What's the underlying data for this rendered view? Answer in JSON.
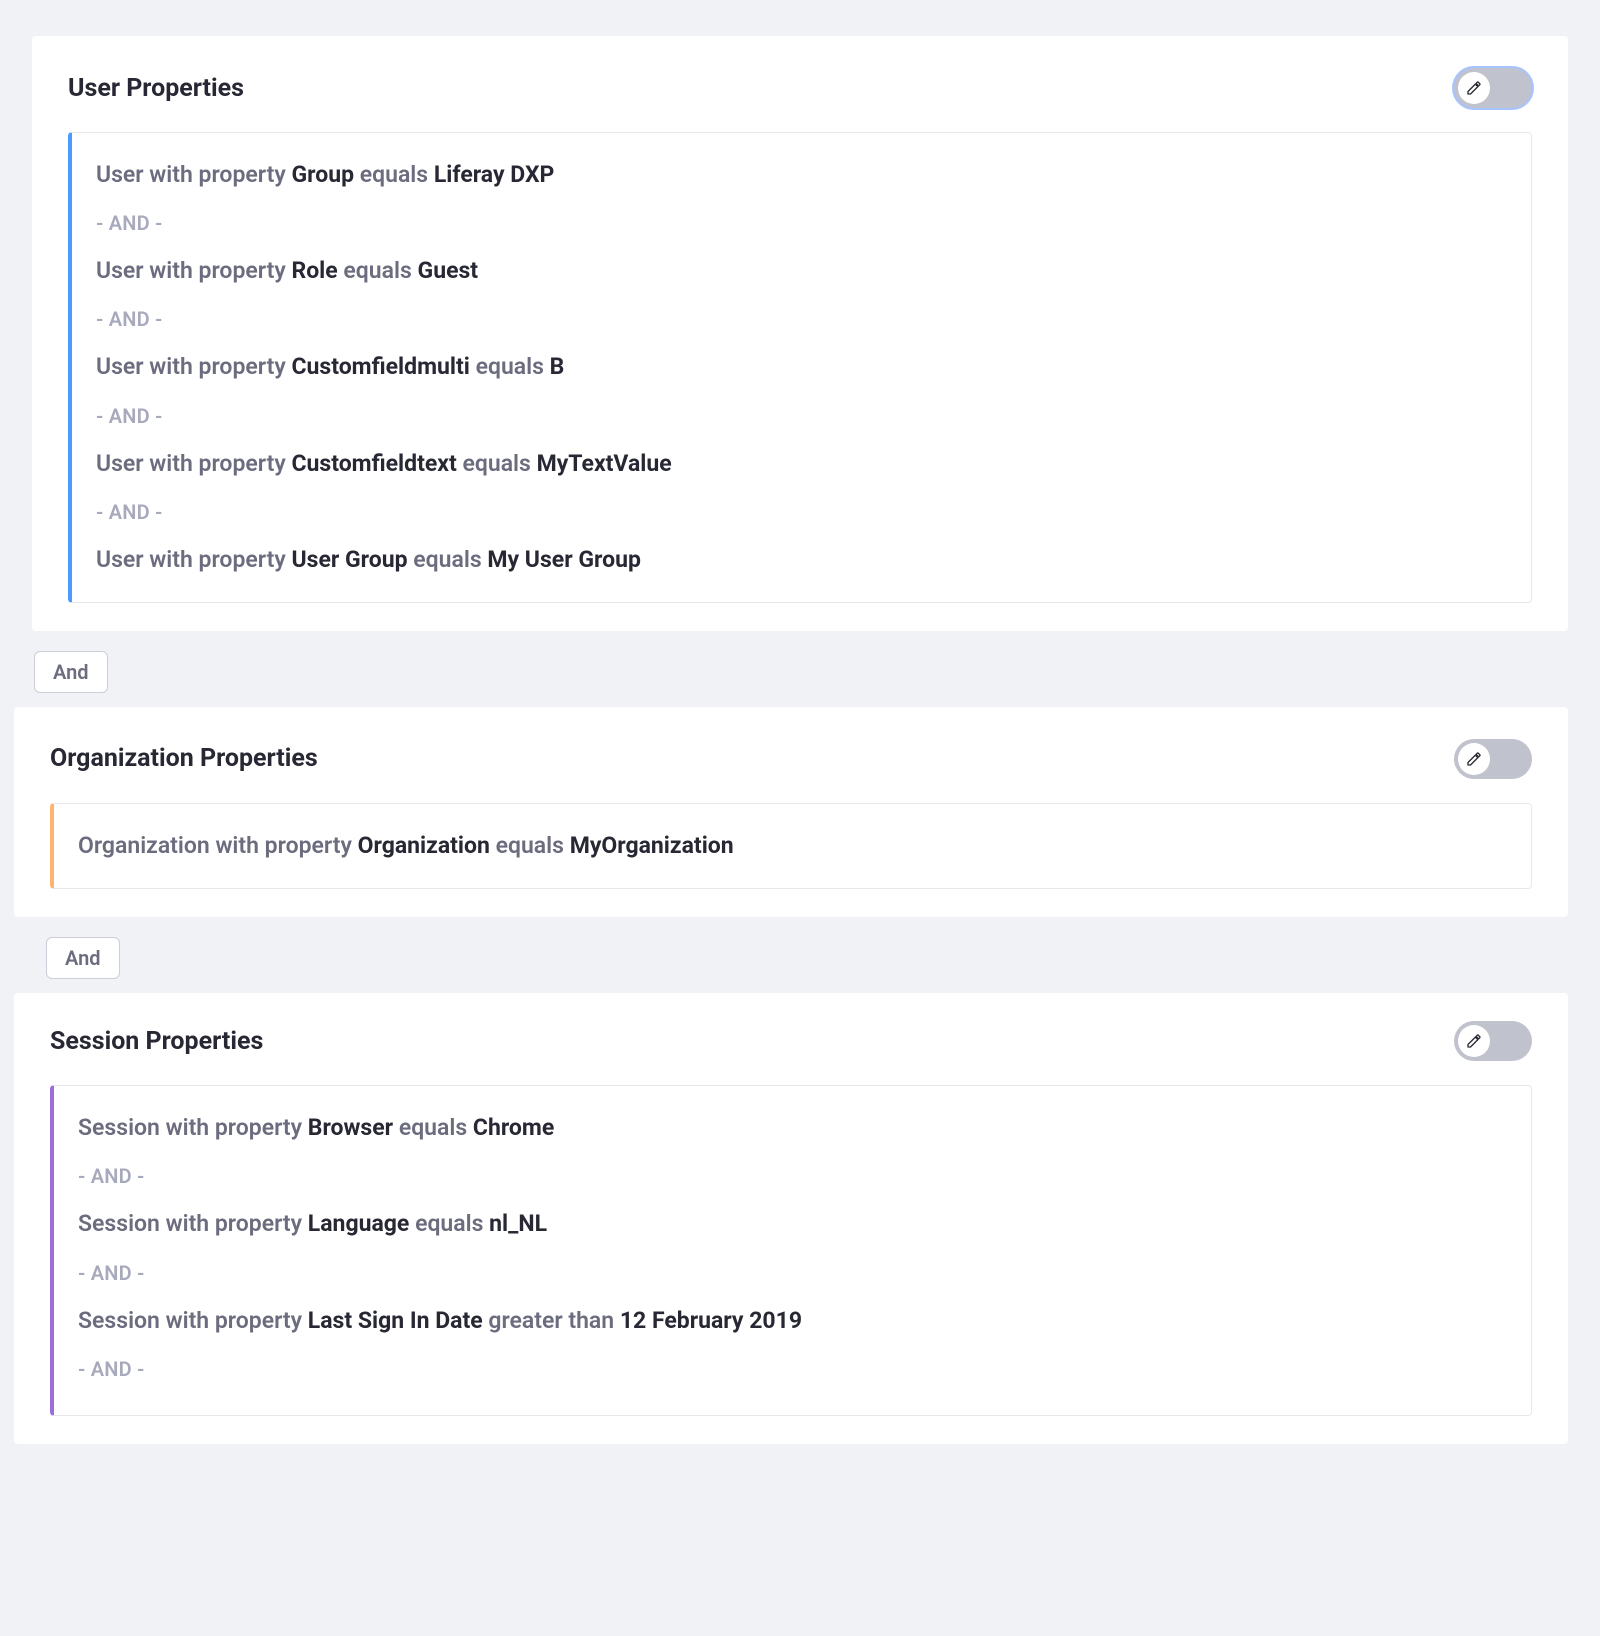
{
  "connectors": {
    "and_inner": "- AND -",
    "and_outer": "And"
  },
  "user": {
    "title": "User Properties",
    "prefix": "User with property",
    "equals": "equals",
    "rules": [
      {
        "prop": "Group",
        "op": "equals",
        "val": "Liferay DXP"
      },
      {
        "prop": "Role",
        "op": "equals",
        "val": "Guest"
      },
      {
        "prop": "Customfieldmulti",
        "op": "equals",
        "val": "B"
      },
      {
        "prop": "Customfieldtext",
        "op": "equals",
        "val": "MyTextValue"
      },
      {
        "prop": "User Group",
        "op": "equals",
        "val": "My User Group"
      }
    ]
  },
  "org": {
    "title": "Organization Properties",
    "prefix": "Organization with property",
    "rules": [
      {
        "prop": "Organization",
        "op": "equals",
        "val": "MyOrganization"
      }
    ]
  },
  "session": {
    "title": "Session Properties",
    "prefix": "Session with property",
    "rules": [
      {
        "prop": "Browser",
        "op": "equals",
        "val": "Chrome"
      },
      {
        "prop": "Language",
        "op": "equals",
        "val": "nl_NL"
      },
      {
        "prop": "Last Sign In Date",
        "op": "greater than",
        "val": "12 February 2019"
      }
    ]
  }
}
